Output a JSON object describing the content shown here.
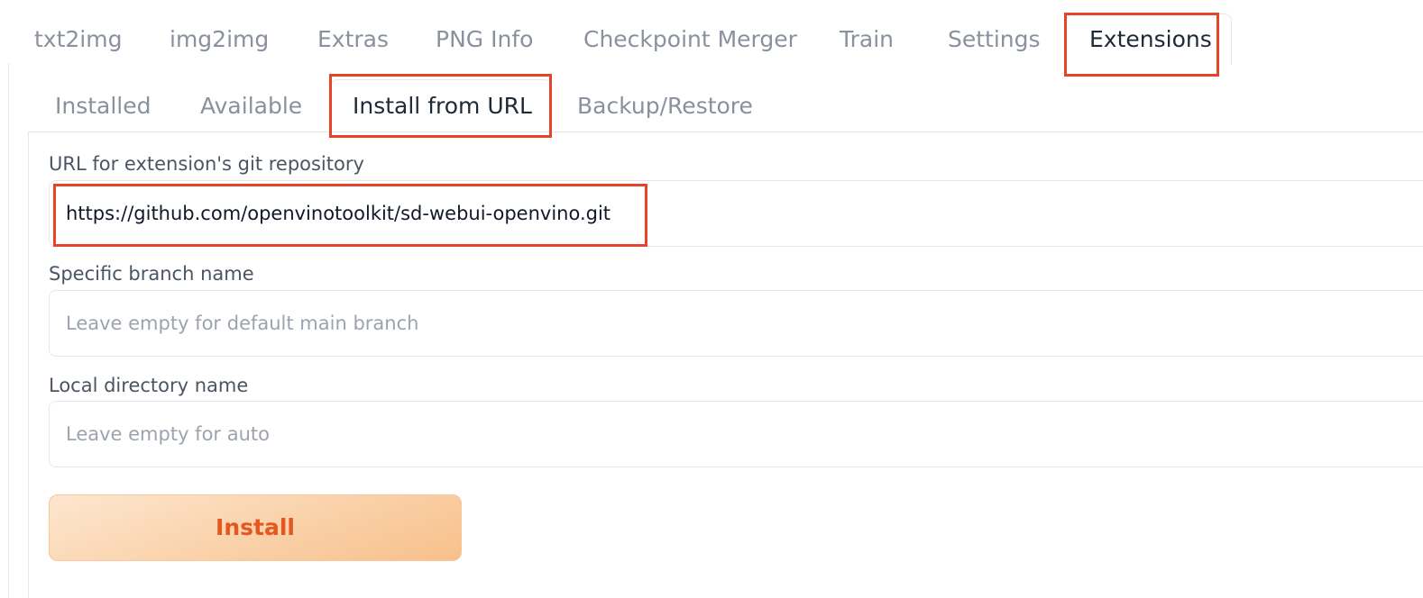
{
  "top_tabs": [
    {
      "label": "txt2img"
    },
    {
      "label": "img2img"
    },
    {
      "label": "Extras"
    },
    {
      "label": "PNG Info"
    },
    {
      "label": "Checkpoint Merger"
    },
    {
      "label": "Train"
    },
    {
      "label": "Settings"
    },
    {
      "label": "Extensions"
    }
  ],
  "top_tabs_active": "Extensions",
  "sub_tabs": [
    {
      "label": "Installed"
    },
    {
      "label": "Available"
    },
    {
      "label": "Install from URL"
    },
    {
      "label": "Backup/Restore"
    }
  ],
  "sub_tabs_active": "Install from URL",
  "form": {
    "url": {
      "label": "URL for extension's git repository",
      "value": "https://github.com/openvinotoolkit/sd-webui-openvino.git",
      "placeholder": ""
    },
    "branch": {
      "label": "Specific branch name",
      "value": "",
      "placeholder": "Leave empty for default main branch"
    },
    "directory": {
      "label": "Local directory name",
      "value": "",
      "placeholder": "Leave empty for auto"
    },
    "install_label": "Install"
  },
  "colors": {
    "highlight": "#e5442b",
    "install_text": "#e4571f",
    "install_bg_start": "#fde6cf",
    "install_bg_end": "#f7c08a",
    "active_tab_text": "#1f2937",
    "inactive_tab_text": "#8a919e"
  }
}
